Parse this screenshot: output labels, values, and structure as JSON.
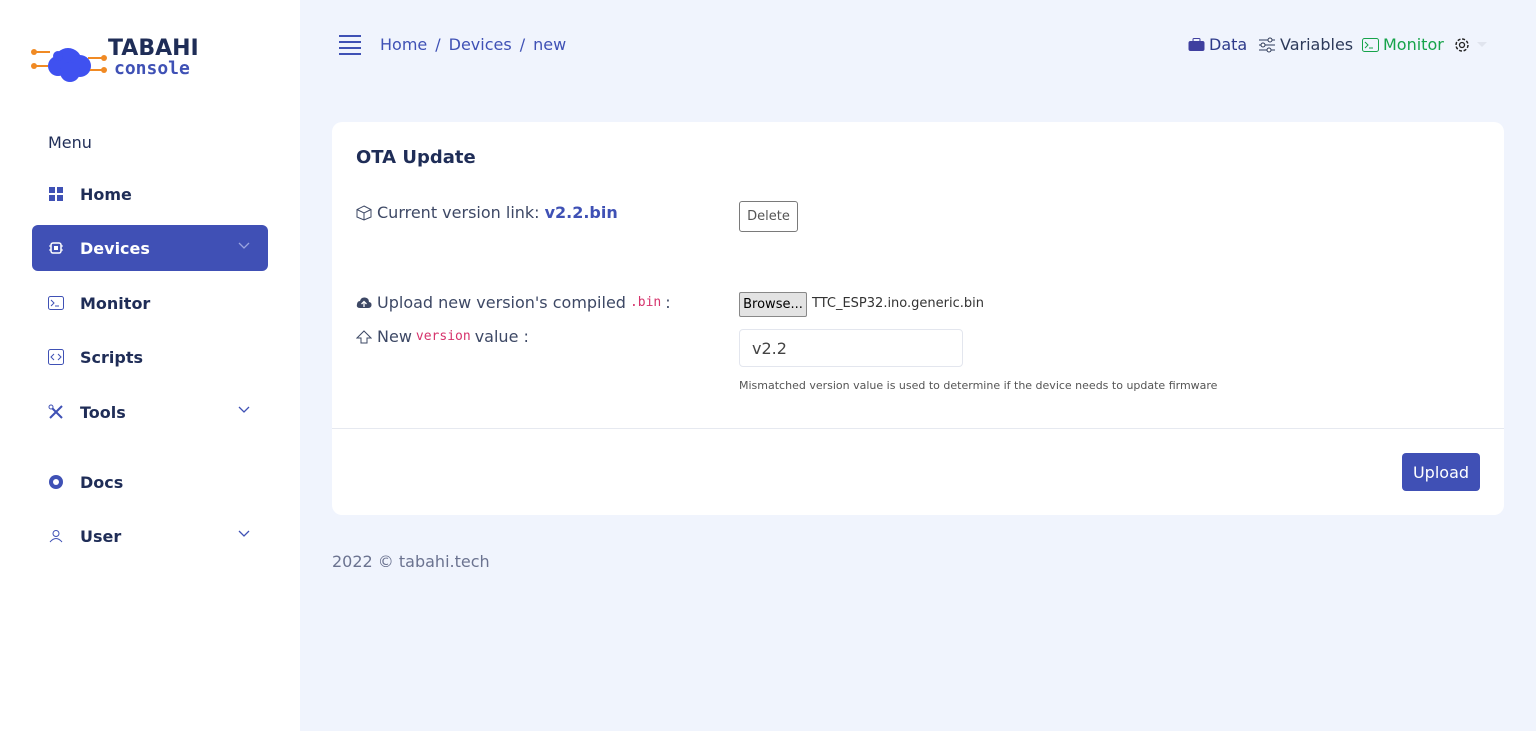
{
  "app": {
    "logo_text": "TABAHI",
    "logo_subtext": "console"
  },
  "sidebar": {
    "menu_title": "Menu",
    "items": [
      {
        "label": "Home",
        "icon": "grid-icon"
      },
      {
        "label": "Devices",
        "icon": "chip-icon",
        "active": true
      },
      {
        "label": "Monitor",
        "icon": "terminal-icon"
      },
      {
        "label": "Scripts",
        "icon": "code-icon"
      },
      {
        "label": "Tools",
        "icon": "tools-icon"
      },
      {
        "label": "Docs",
        "icon": "lifebuoy-icon"
      },
      {
        "label": "User",
        "icon": "user-icon"
      }
    ]
  },
  "breadcrumb": [
    "Home",
    "Devices",
    "new"
  ],
  "breadcrumb_sep": "/",
  "topnav": {
    "data": "Data",
    "variables": "Variables",
    "monitor": "Monitor"
  },
  "card": {
    "title": "OTA Update",
    "current_version_label": "Current version link:",
    "current_version_link": "v2.2.bin",
    "delete_label": "Delete",
    "upload_label_pre": "Upload new version's compiled",
    "upload_label_code": ".bin",
    "upload_label_post": ":",
    "browse_label": "Browse...",
    "file_name": "TTC_ESP32.ino.generic.bin",
    "version_label_pre": "New",
    "version_label_code": "version",
    "version_label_post": "value :",
    "version_value": "v2.2",
    "help_text": "Mismatched version value is used to determine if the device needs to update firmware",
    "upload_button": "Upload"
  },
  "footer": "2022 © tabahi.tech",
  "colors": {
    "accent": "#4050b5",
    "monitor": "#16a34a",
    "background": "#f0f4fd"
  }
}
